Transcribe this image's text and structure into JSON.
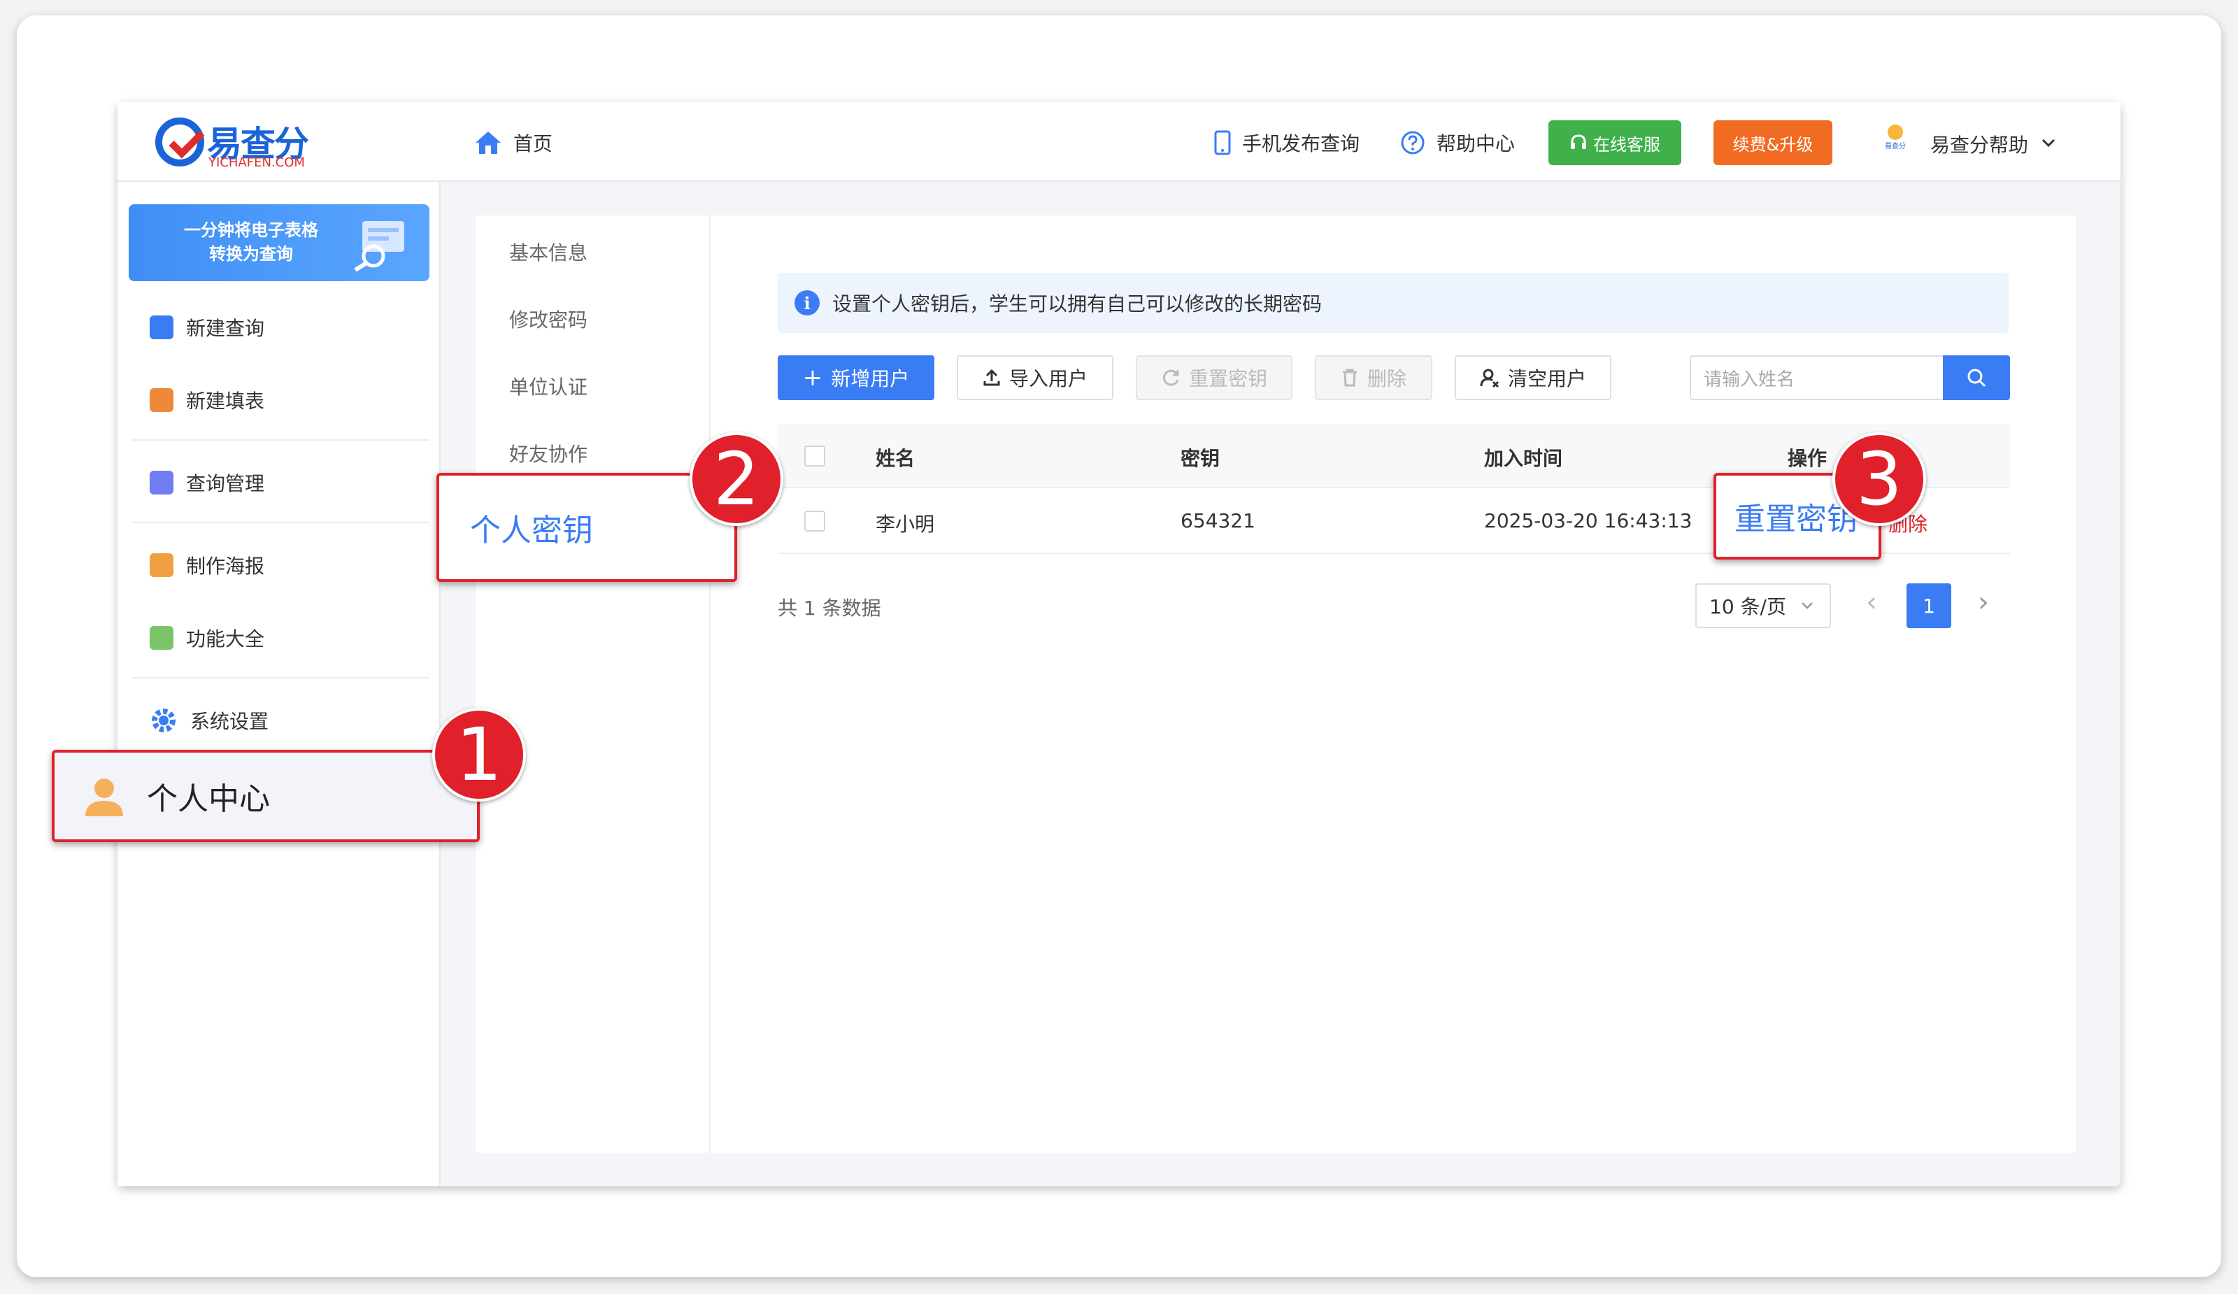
{
  "logo": {
    "text": "易查分",
    "sub": "YICHAFEN.COM"
  },
  "header": {
    "home": "首页",
    "mobile": "手机发布查询",
    "help": "帮助中心",
    "service": "在线客服",
    "upgrade": "续费&升级",
    "user": "易查分帮助",
    "avatar_text": "易查分"
  },
  "sidebar": {
    "banner_line1": "一分钟将电子表格",
    "banner_line2": "转换为查询",
    "items": [
      {
        "label": "新建查询",
        "color": "#3a7cf4"
      },
      {
        "label": "新建填表",
        "color": "#f0883a"
      },
      {
        "label": "查询管理",
        "color": "#6f7cf2"
      },
      {
        "label": "制作海报",
        "color": "#f0a040"
      },
      {
        "label": "功能大全",
        "color": "#7cc46a"
      },
      {
        "label": "系统设置",
        "color": "#3a7cf4"
      }
    ],
    "active": "个人中心"
  },
  "subnav": {
    "items": [
      "基本信息",
      "修改密码",
      "单位认证",
      "好友协作"
    ],
    "active": "个人密钥"
  },
  "notice": {
    "icon": "i",
    "text": "设置个人密钥后，学生可以拥有自己可以修改的长期密码"
  },
  "toolbar": {
    "add": "新增用户",
    "import": "导入用户",
    "reset": "重置密钥",
    "delete": "删除",
    "clear": "清空用户",
    "search_placeholder": "请输入姓名"
  },
  "table": {
    "headers": [
      "姓名",
      "密钥",
      "加入时间",
      "操作"
    ],
    "rows": [
      {
        "name": "李小明",
        "key": "654321",
        "time": "2025-03-20 16:43:13",
        "action_reset": "重置密钥",
        "action_delete": "删除"
      }
    ]
  },
  "pager": {
    "total": "共 1 条数据",
    "size": "10 条/页",
    "current": "1",
    "prev": "‹",
    "next": "›"
  },
  "callouts": [
    "1",
    "2",
    "3"
  ]
}
